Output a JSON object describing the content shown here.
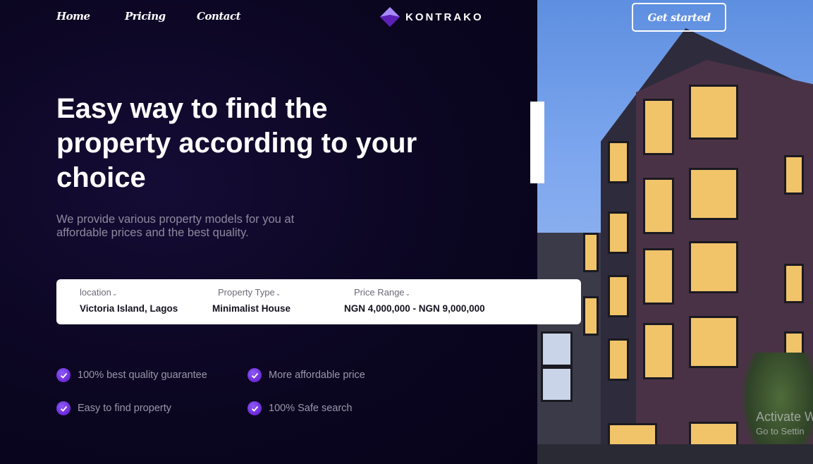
{
  "nav": {
    "links": [
      {
        "label": "Home"
      },
      {
        "label": "Pricing"
      },
      {
        "label": "Contact"
      }
    ],
    "brand": "KONTRAKO",
    "cta_label": "Get started"
  },
  "hero": {
    "title": "Easy way to find the property according to your choice",
    "subtitle": "We provide various property models for you at affordable prices and the best quality."
  },
  "search": {
    "location": {
      "label": "location",
      "value": "Victoria Island, Lagos"
    },
    "property_type": {
      "label": "Property Type",
      "value": "Minimalist House"
    },
    "price_range": {
      "label": "Price Range",
      "value": "NGN 4,000,000 - NGN 9,000,000"
    }
  },
  "features": [
    {
      "text": "100% best quality guarantee"
    },
    {
      "text": "More affordable price"
    },
    {
      "text": "Easy to find property"
    },
    {
      "text": "100% Safe search"
    }
  ],
  "watermark": {
    "line1": "Activate W",
    "line2": "Go to Settin"
  },
  "colors": {
    "background": "#0b0621",
    "accent": "#7c3aed",
    "card": "#ffffff",
    "muted_text": "#9a97aa"
  },
  "icons": {
    "brand": "kontrako-logo-icon",
    "feature": "check-circle-icon",
    "dropdown": "chevron-down-icon"
  }
}
